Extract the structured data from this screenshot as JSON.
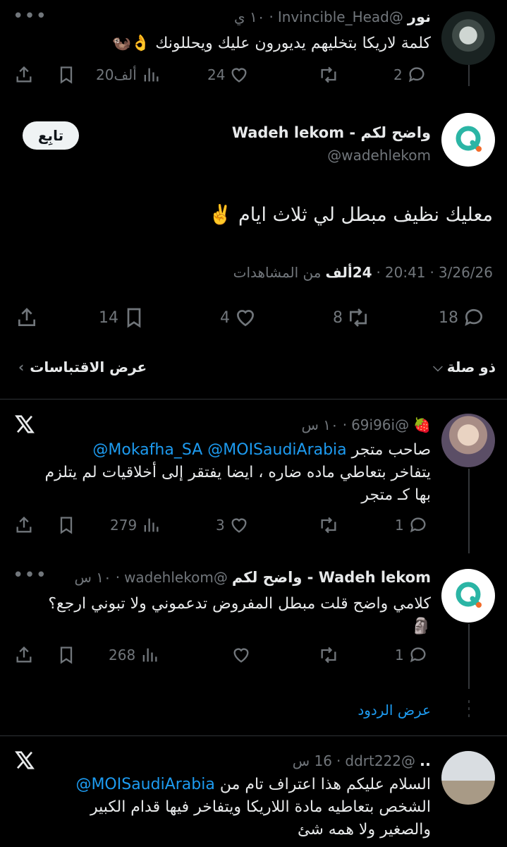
{
  "tweet1": {
    "name": "نور",
    "handle": "@Invincible_Head",
    "time": "١٠ ي",
    "text": "كلمة لاريكا بتخليهم يديورون عليك ويحللونك 👌🦦",
    "replies": "2",
    "retweets": "",
    "likes": "24",
    "views": "20ألف"
  },
  "main": {
    "name": "Wadeh lekom - واضح لكم",
    "handle": "@wadehlekom",
    "follow_label": "تابِع",
    "text": "معليك نظيف مبطل لي ثلاث ايام ✌️",
    "date": "3/26/26",
    "time": "20:41",
    "views_count": "24ألف",
    "views_label": "من المشاهدات",
    "replies": "18",
    "retweets": "8",
    "likes": "4",
    "bookmarks": "14",
    "related_label": "ذو صلة",
    "quotes_label": "عرض الاقتباسات"
  },
  "reply1": {
    "handle": "@69i96i",
    "time": "١٠ س",
    "mention1": "@MOISaudiArabia",
    "mention2": "@Mokafha_SA",
    "line1_rest": "صاحب متجر",
    "line2": "يتفاخر بتعاطي ماده ضاره ، ايضا يفتقر إلى أخلاقيات لم يتلزم",
    "line3": "بها كـ متجر",
    "replies": "1",
    "likes": "3",
    "views": "279"
  },
  "reply2": {
    "name": "Wadeh lekom - واضح لكم",
    "handle": "@wadehlekom",
    "time": "١٠ س",
    "line1": "كلامي واضح قلت مبطل المفروض تدعموني ولا تبوني ارجع؟",
    "line2": "🗿",
    "replies": "1",
    "views": "268"
  },
  "show_replies_label": "عرض الردود",
  "reply3": {
    "name": "..",
    "handle": "@ddrt222",
    "time": "16 س",
    "mention": "@MOISaudiArabia",
    "line1_rest": "السلام عليكم هذا اعتراف تام من",
    "line2": "الشخص بتعاطيه مادة اللاريكا ويتفاخر فيها قدام الكبير",
    "line3": "والصغير ولا همه شئ"
  },
  "colors": {
    "background": "#000000",
    "text": "#e7e9ea",
    "muted": "#71767b",
    "link": "#1d9bf0",
    "divider": "#2f3336",
    "brand_teal": "#2bb5a5",
    "brand_orange": "#f26b2a"
  }
}
